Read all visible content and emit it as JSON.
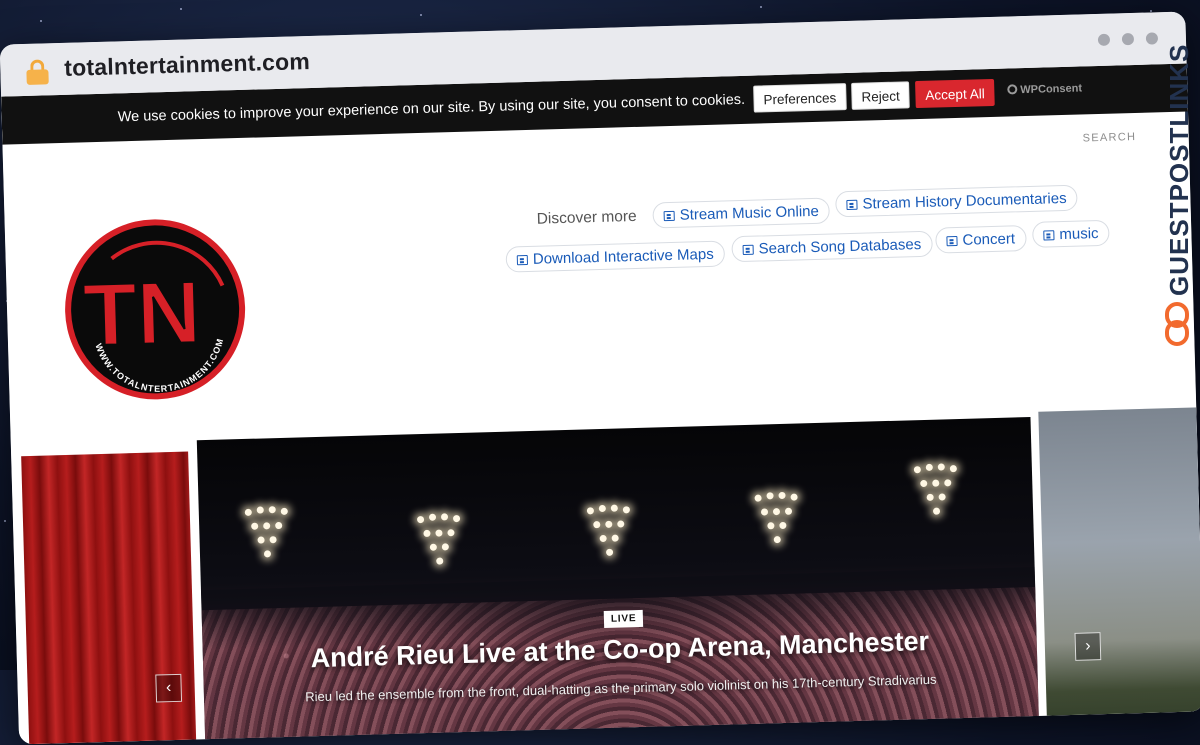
{
  "browser": {
    "url": "totalntertainment.com"
  },
  "cookie_banner": {
    "text": "We use cookies to improve your experience on our site. By using our site, you consent to cookies.",
    "preferences_label": "Preferences",
    "reject_label": "Reject",
    "accept_label": "Accept All",
    "brand": "WPConsent"
  },
  "header": {
    "search_label": "SEARCH",
    "logo_text": "WWW.TOTALNTERTAINMENT.COM",
    "logo_letters": "TN"
  },
  "discover": {
    "label": "Discover more",
    "chips": [
      "Stream Music Online",
      "Stream History Documentaries",
      "Download Interactive Maps",
      "Search Song Databases",
      "Concert",
      "music"
    ]
  },
  "slider": {
    "tag": "LIVE",
    "headline": "André Rieu Live at the Co-op Arena, Manchester",
    "subtext": "Rieu led the ensemble from the front, dual-hatting as the primary solo violinist on his 17th-century Stradivarius",
    "prev_icon": "chevron-left-icon",
    "next_icon": "chevron-right-icon"
  },
  "watermark": {
    "text": "GUESTPOSTLINKS"
  },
  "colors": {
    "accept": "#d9272e",
    "link": "#1a5bb8",
    "watermark": "#22324f",
    "watermark_accent": "#f26a2e"
  }
}
